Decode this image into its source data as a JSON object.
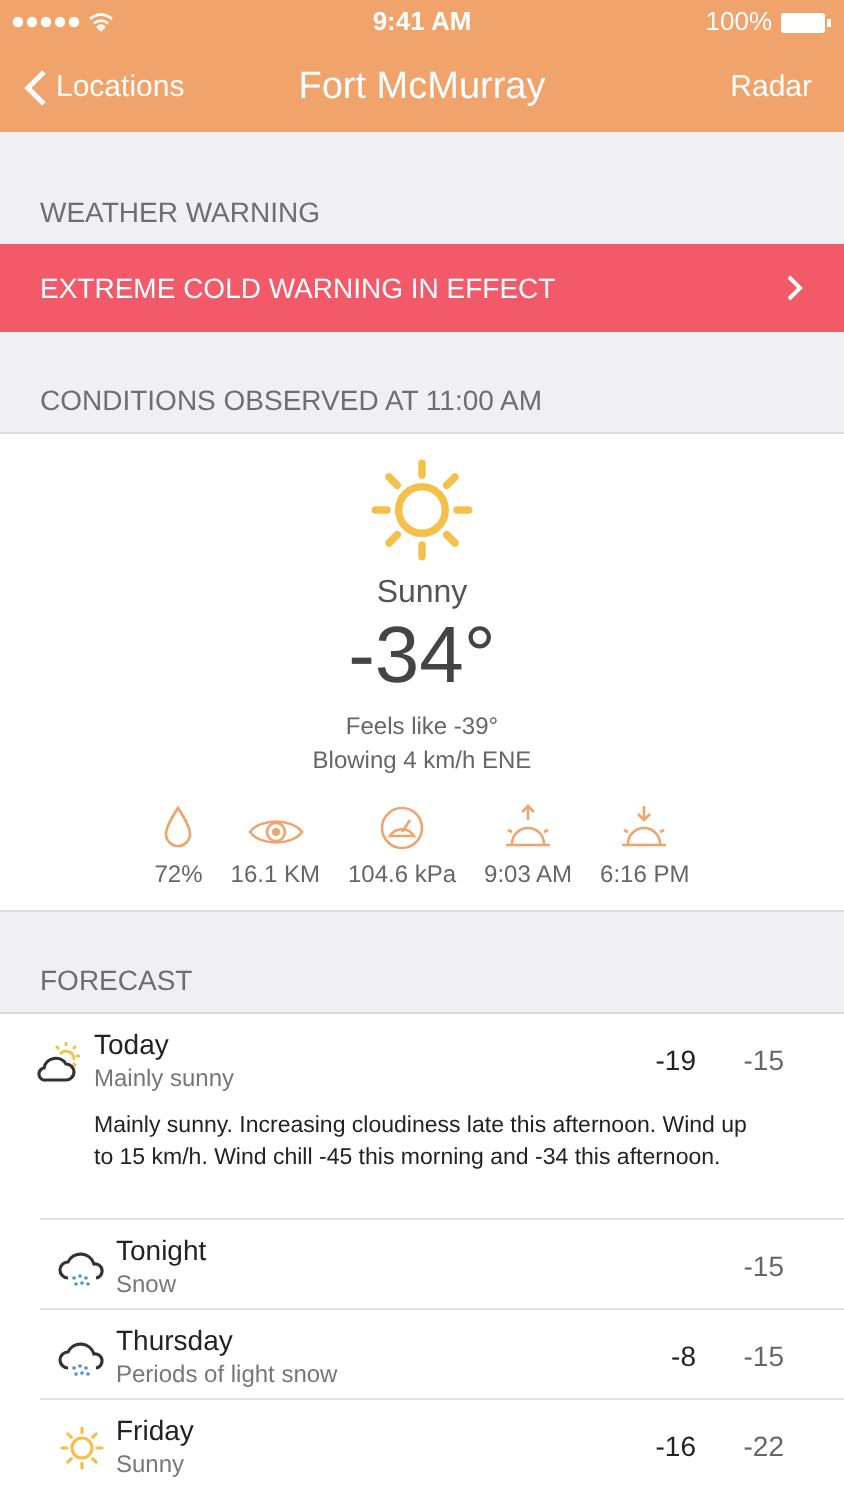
{
  "status_bar": {
    "time": "9:41 AM",
    "battery": "100%"
  },
  "nav": {
    "back": "Locations",
    "title": "Fort McMurray",
    "action": "Radar"
  },
  "warning": {
    "header": "WEATHER WARNING",
    "message": "EXTREME COLD WARNING IN EFFECT"
  },
  "conditions": {
    "header": "CONDITIONS OBSERVED AT 11:00 AM",
    "condition": "Sunny",
    "temperature": "-34°",
    "feels_like": "Feels like -39°",
    "wind": "Blowing 4 km/h ENE",
    "stats": [
      {
        "kind": "humidity",
        "value": "72%"
      },
      {
        "kind": "visibility",
        "value": "16.1 KM"
      },
      {
        "kind": "pressure",
        "value": "104.6 kPa"
      },
      {
        "kind": "sunrise",
        "value": "9:03 AM"
      },
      {
        "kind": "sunset",
        "value": "6:16 PM"
      }
    ]
  },
  "forecast": {
    "header": "FORECAST",
    "days": [
      {
        "kind": "cloud-sun",
        "day": "Today",
        "summary": "Mainly sunny",
        "high": "-19",
        "low": "-15",
        "details": "Mainly sunny. Increasing cloudiness late this afternoon. Wind up to 15 km/h. Wind chill -45 this morning and -34 this afternoon."
      },
      {
        "kind": "snow",
        "day": "Tonight",
        "summary": "Snow",
        "low": "-15"
      },
      {
        "kind": "snow",
        "day": "Thursday",
        "summary": "Periods of light snow",
        "high": "-8",
        "low": "-15"
      },
      {
        "kind": "sun",
        "day": "Friday",
        "summary": "Sunny",
        "high": "-16",
        "low": "-22"
      }
    ]
  }
}
